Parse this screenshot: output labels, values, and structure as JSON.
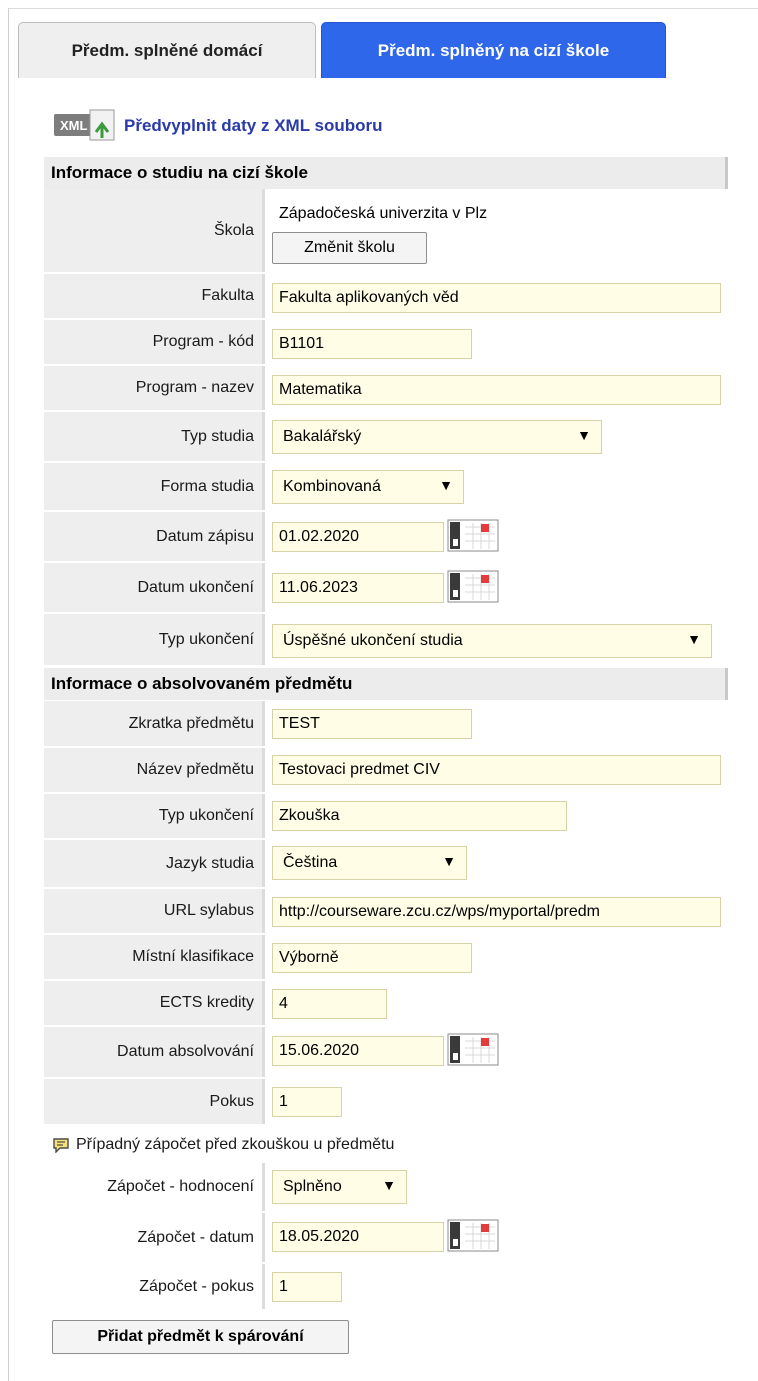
{
  "tabs": {
    "home": "Předm. splněné domácí",
    "foreign": "Předm. splněný na cizí škole"
  },
  "xml": {
    "icon_text": "XML",
    "link": "Předvyplnit daty z XML souboru"
  },
  "section_study": {
    "title": "Informace o studiu na cizí škole",
    "school_label": "Škola",
    "school_value": "Západočeská univerzita v Plz",
    "change_school_button": "Změnit školu",
    "faculty_label": "Fakulta",
    "faculty_value": "Fakulta aplikovaných věd",
    "program_code_label": "Program - kód",
    "program_code_value": "B1101",
    "program_name_label": "Program - nazev",
    "program_name_value": "Matematika",
    "study_type_label": "Typ studia",
    "study_type_value": "Bakalářský",
    "study_form_label": "Forma studia",
    "study_form_value": "Kombinovaná",
    "enroll_date_label": "Datum zápisu",
    "enroll_date_value": "01.02.2020",
    "end_date_label": "Datum ukončení",
    "end_date_value": "11.06.2023",
    "end_type_label": "Typ ukončení",
    "end_type_value": "Úspěšné ukončení studia"
  },
  "section_subject": {
    "title": "Informace o absolvovaném předmětu",
    "abbr_label": "Zkratka předmětu",
    "abbr_value": "TEST",
    "name_label": "Název předmětu",
    "name_value": "Testovaci predmet CIV",
    "completion_label": "Typ ukončení",
    "completion_value": "Zkouška",
    "language_label": "Jazyk studia",
    "language_value": "Čeština",
    "url_label": "URL sylabus",
    "url_value": "http://courseware.zcu.cz/wps/myportal/predm",
    "grade_label": "Místní klasifikace",
    "grade_value": "Výborně",
    "ects_label": "ECTS kredity",
    "ects_value": "4",
    "passed_date_label": "Datum absolvování",
    "passed_date_value": "15.06.2020",
    "attempt_label": "Pokus",
    "attempt_value": "1"
  },
  "credit": {
    "note": "Případný zápočet před zkouškou u předmětu",
    "eval_label": "Zápočet - hodnocení",
    "eval_value": "Splněno",
    "date_label": "Zápočet - datum",
    "date_value": "18.05.2020",
    "attempt_label": "Zápočet - pokus",
    "attempt_value": "1"
  },
  "actions": {
    "add_button": "Přidat předmět k spárování"
  },
  "icons": {
    "dropdown": "▼",
    "xml_file": "xml-file-icon",
    "calendar": "calendar-icon",
    "comment": "comment-icon"
  },
  "colors": {
    "active_tab": "#2f67ea",
    "input_bg": "#fffde6",
    "link": "#2a3aa8"
  }
}
